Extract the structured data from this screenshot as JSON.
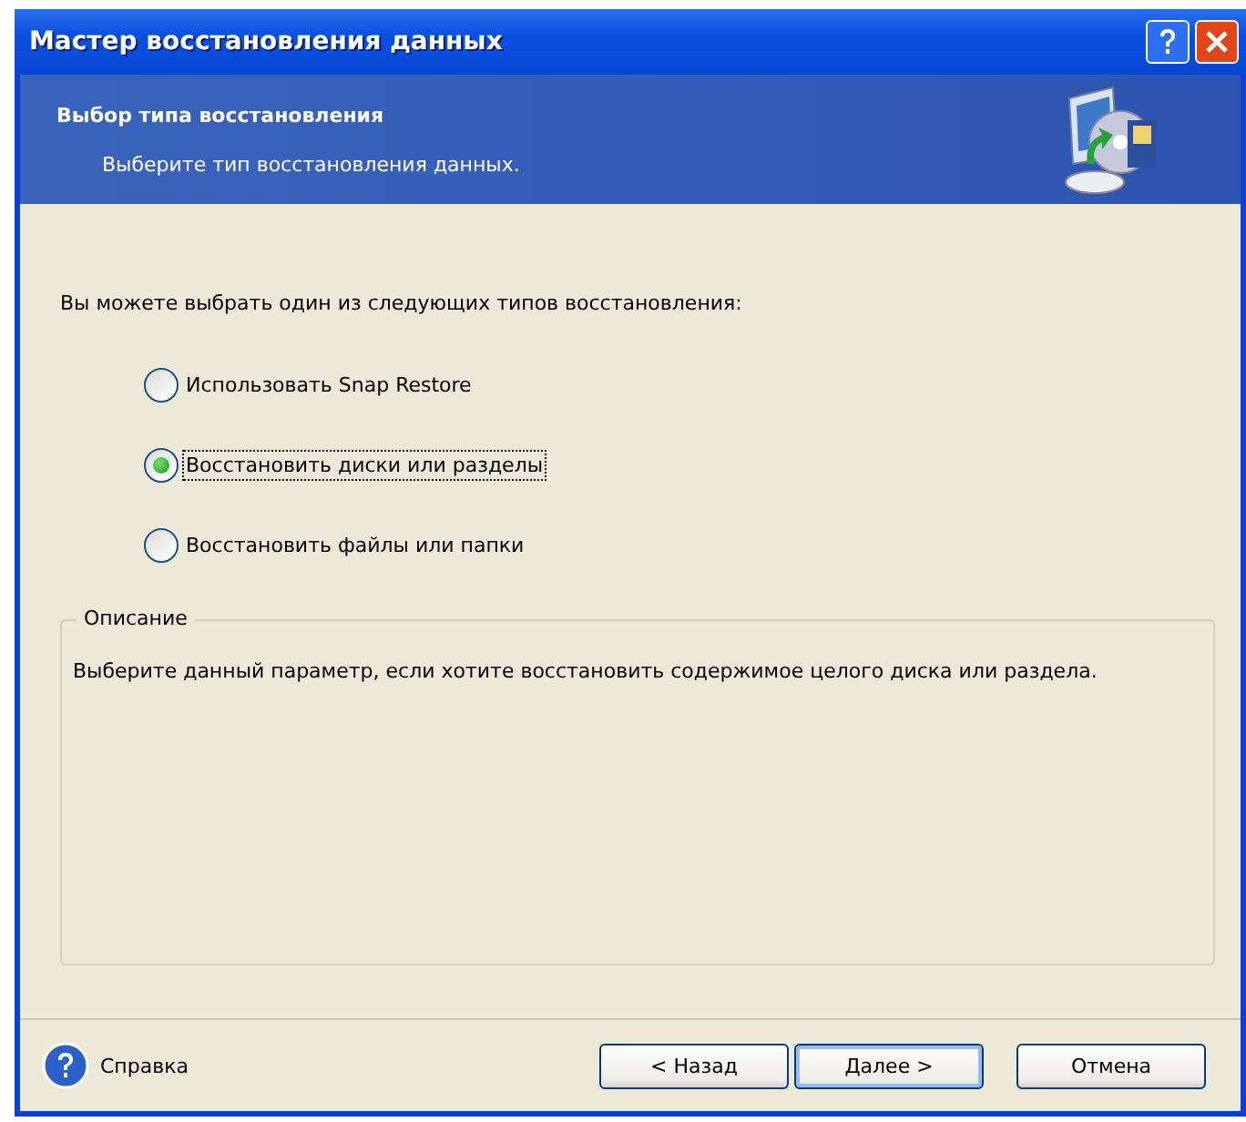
{
  "window": {
    "title": "Мастер восстановления данных"
  },
  "header": {
    "title": "Выбор типа восстановления",
    "subtitle": "Выберите тип восстановления данных."
  },
  "prompt": "Вы можете выбрать один из следующих типов восстановления:",
  "options": [
    {
      "label": "Использовать Snap Restore",
      "selected": false
    },
    {
      "label": "Восстановить диски или разделы",
      "selected": true
    },
    {
      "label": "Восстановить файлы или папки",
      "selected": false
    }
  ],
  "description": {
    "legend": "Описание",
    "text": "Выберите данный параметр, если хотите восстановить содержимое целого диска или раздела."
  },
  "help": "Справка",
  "buttons": [
    {
      "label": "< Назад",
      "default": false
    },
    {
      "label": "Далее >",
      "default": true
    },
    {
      "label": "Отмена",
      "default": false
    }
  ]
}
